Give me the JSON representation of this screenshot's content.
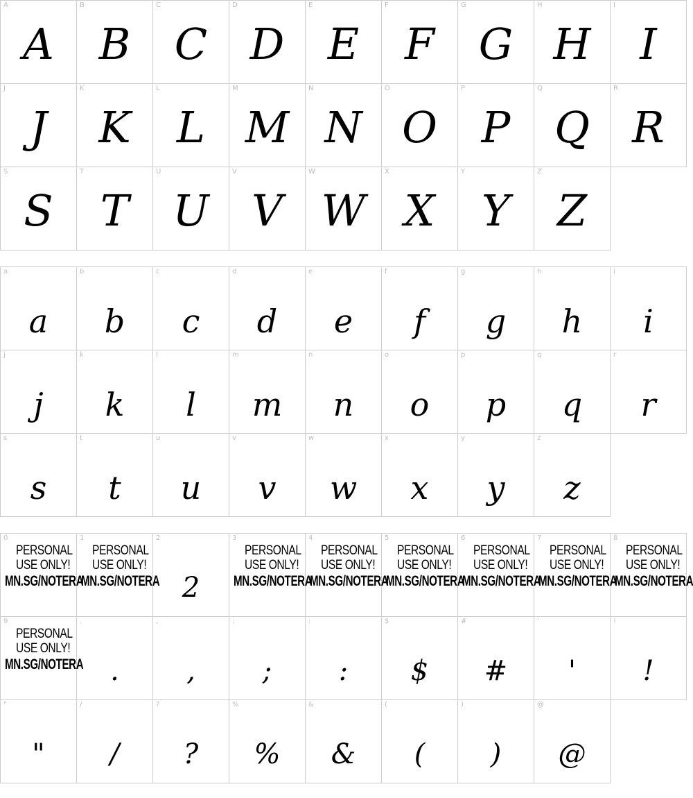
{
  "sections": [
    {
      "cells": [
        {
          "key": "A",
          "glyph": "A"
        },
        {
          "key": "B",
          "glyph": "B"
        },
        {
          "key": "C",
          "glyph": "C"
        },
        {
          "key": "D",
          "glyph": "D"
        },
        {
          "key": "E",
          "glyph": "E"
        },
        {
          "key": "F",
          "glyph": "F"
        },
        {
          "key": "G",
          "glyph": "G"
        },
        {
          "key": "H",
          "glyph": "H"
        },
        {
          "key": "I",
          "glyph": "I"
        },
        {
          "key": "J",
          "glyph": "J"
        },
        {
          "key": "K",
          "glyph": "K"
        },
        {
          "key": "L",
          "glyph": "L"
        },
        {
          "key": "M",
          "glyph": "M"
        },
        {
          "key": "N",
          "glyph": "N"
        },
        {
          "key": "O",
          "glyph": "O"
        },
        {
          "key": "P",
          "glyph": "P"
        },
        {
          "key": "Q",
          "glyph": "Q"
        },
        {
          "key": "R",
          "glyph": "R"
        },
        {
          "key": "S",
          "glyph": "S"
        },
        {
          "key": "T",
          "glyph": "T"
        },
        {
          "key": "U",
          "glyph": "U"
        },
        {
          "key": "V",
          "glyph": "V"
        },
        {
          "key": "W",
          "glyph": "W"
        },
        {
          "key": "X",
          "glyph": "X"
        },
        {
          "key": "Y",
          "glyph": "Y"
        },
        {
          "key": "Z",
          "glyph": "Z"
        }
      ]
    },
    {
      "cells": [
        {
          "key": "a",
          "glyph": "a"
        },
        {
          "key": "b",
          "glyph": "b"
        },
        {
          "key": "c",
          "glyph": "c"
        },
        {
          "key": "d",
          "glyph": "d"
        },
        {
          "key": "e",
          "glyph": "e"
        },
        {
          "key": "f",
          "glyph": "f"
        },
        {
          "key": "g",
          "glyph": "g"
        },
        {
          "key": "h",
          "glyph": "h"
        },
        {
          "key": "i",
          "glyph": "i"
        },
        {
          "key": "j",
          "glyph": "j"
        },
        {
          "key": "k",
          "glyph": "k"
        },
        {
          "key": "l",
          "glyph": "l"
        },
        {
          "key": "m",
          "glyph": "m"
        },
        {
          "key": "n",
          "glyph": "n"
        },
        {
          "key": "o",
          "glyph": "o"
        },
        {
          "key": "p",
          "glyph": "p"
        },
        {
          "key": "q",
          "glyph": "q"
        },
        {
          "key": "r",
          "glyph": "r"
        },
        {
          "key": "s",
          "glyph": "s"
        },
        {
          "key": "t",
          "glyph": "t"
        },
        {
          "key": "u",
          "glyph": "u"
        },
        {
          "key": "v",
          "glyph": "v"
        },
        {
          "key": "w",
          "glyph": "w"
        },
        {
          "key": "x",
          "glyph": "x"
        },
        {
          "key": "y",
          "glyph": "y"
        },
        {
          "key": "z",
          "glyph": "z"
        }
      ]
    },
    {
      "cells": [
        {
          "key": "0",
          "watermark": true
        },
        {
          "key": "1",
          "watermark": true
        },
        {
          "key": "2",
          "glyph": "2"
        },
        {
          "key": "3",
          "watermark": true
        },
        {
          "key": "4",
          "watermark": true
        },
        {
          "key": "5",
          "watermark": true
        },
        {
          "key": "6",
          "watermark": true
        },
        {
          "key": "7",
          "watermark": true
        },
        {
          "key": "8",
          "watermark": true
        },
        {
          "key": "9",
          "watermark": true
        },
        {
          "key": ".",
          "glyph": "."
        },
        {
          "key": ",",
          "glyph": ","
        },
        {
          "key": ";",
          "glyph": ";"
        },
        {
          "key": ":",
          "glyph": ":"
        },
        {
          "key": "$",
          "glyph": "$"
        },
        {
          "key": "#",
          "glyph": "#"
        },
        {
          "key": "'",
          "glyph": "'"
        },
        {
          "key": "!",
          "glyph": "!"
        },
        {
          "key": "\"",
          "glyph": "\""
        },
        {
          "key": "/",
          "glyph": "/"
        },
        {
          "key": "?",
          "glyph": "?"
        },
        {
          "key": "%",
          "glyph": "%"
        },
        {
          "key": "&",
          "glyph": "&"
        },
        {
          "key": "(",
          "glyph": "("
        },
        {
          "key": ")",
          "glyph": ")"
        },
        {
          "key": "@",
          "glyph": "@"
        }
      ]
    }
  ],
  "watermark": {
    "line1": "PERSONAL",
    "line2": "USE ONLY!",
    "line3": "MN.SG/NOTERA"
  },
  "colors": {
    "grid_line": "#cccccc",
    "key_label": "#bdbdbd",
    "glyph": "#000000"
  }
}
